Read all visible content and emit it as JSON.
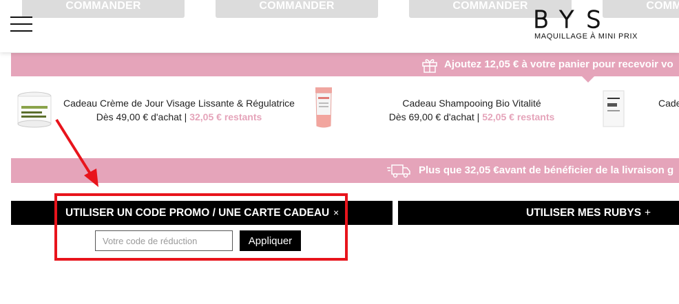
{
  "header": {
    "order_buttons": [
      "COMMANDER",
      "COMMANDER",
      "COMMANDER",
      "COMMANDER"
    ],
    "logo_text": "BYS",
    "logo_tagline": "MAQUILLAGE À MINI PRIX"
  },
  "gift_banner": {
    "text": "Ajoutez 12,05 € à votre panier pour recevoir vo"
  },
  "gifts": [
    {
      "title": "Cadeau Crème de Jour Visage Lissante & Régulatrice",
      "threshold": "Dès 49,00 € d'achat |",
      "remaining": "32,05 € restants"
    },
    {
      "title": "Cadeau Shampooing Bio Vitalité",
      "threshold": "Dès 69,00 € d'achat |",
      "remaining": "52,05 € restants"
    },
    {
      "title": "Cade",
      "threshold": "",
      "remaining": ""
    }
  ],
  "shipping_banner": {
    "text": "Plus que 32,05 €avant de bénéficier de la livraison g"
  },
  "promo": {
    "title": "UTILISER UN CODE PROMO / UNE CARTE CADEAU",
    "close_symbol": "×",
    "placeholder": "Votre code de réduction",
    "apply_label": "Appliquer"
  },
  "rubys": {
    "title": "UTILISER MES RUBYS",
    "expand_symbol": "+"
  },
  "colors": {
    "banner_pink": "#e5a4ba",
    "annotation_red": "#e8141c",
    "bar_black": "#000000"
  }
}
